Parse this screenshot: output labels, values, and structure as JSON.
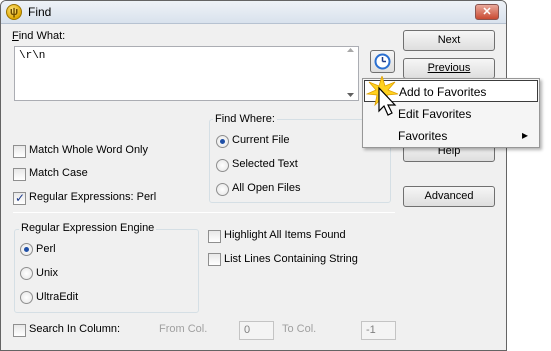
{
  "window": {
    "title": "Find",
    "close_glyph": "✕",
    "app_icon_glyph": "ψ"
  },
  "find_what": {
    "label": "Find What:",
    "value": "\\r\\n"
  },
  "buttons": {
    "next": "Next",
    "previous": "Previous",
    "help": "Help",
    "advanced": "Advanced"
  },
  "find_where": {
    "title": "Find Where:",
    "options": [
      "Current File",
      "Selected Text",
      "All Open Files"
    ],
    "selected": "Current File"
  },
  "options": {
    "match_whole_word": {
      "label": "Match Whole Word Only",
      "checked": false
    },
    "match_case": {
      "label": "Match Case",
      "checked": false
    },
    "regex": {
      "label": "Regular Expressions: Perl",
      "checked": true
    },
    "highlight_all": {
      "label": "Highlight All Items Found",
      "checked": false
    },
    "list_lines": {
      "label": "List Lines Containing String",
      "checked": false
    }
  },
  "regex_engine": {
    "title": "Regular Expression Engine",
    "options": [
      "Perl",
      "Unix",
      "UltraEdit"
    ],
    "selected": "Perl"
  },
  "column_search": {
    "label": "Search In Column:",
    "from_label": "From Col.",
    "from_value": "0",
    "to_label": "To Col.",
    "to_value": "-1"
  },
  "favorites_menu": {
    "items": [
      "Add to Favorites",
      "Edit Favorites",
      "Favorites"
    ],
    "highlighted": "Add to Favorites",
    "submenu_arrow": "▸"
  },
  "colors": {
    "accent": "#1f4fa6",
    "menu_highlight": "#ffffff",
    "title_bar": "#d9e2ed"
  }
}
